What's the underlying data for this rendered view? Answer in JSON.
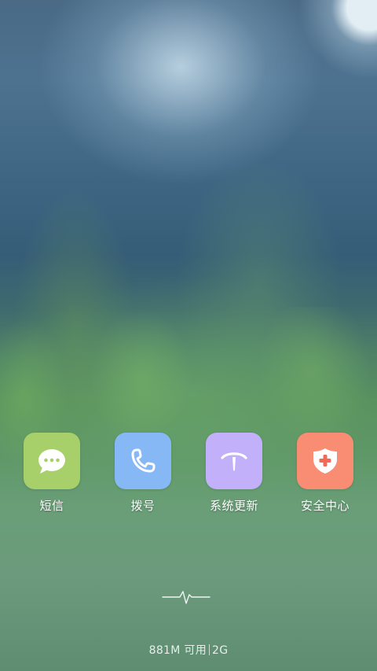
{
  "colors": {
    "messages_icon_bg": "#a7cf6a",
    "dialer_icon_bg": "#86b8f6",
    "update_icon_bg": "#c2b0fa",
    "security_icon_bg": "#f88d74"
  },
  "apps": [
    {
      "label": "短信",
      "icon": "chat-bubble-icon"
    },
    {
      "label": "拨号",
      "icon": "phone-icon"
    },
    {
      "label": "系统更新",
      "icon": "update-icon"
    },
    {
      "label": "安全中心",
      "icon": "shield-icon"
    }
  ],
  "status": {
    "memory": "881M 可用",
    "network": "2G"
  }
}
